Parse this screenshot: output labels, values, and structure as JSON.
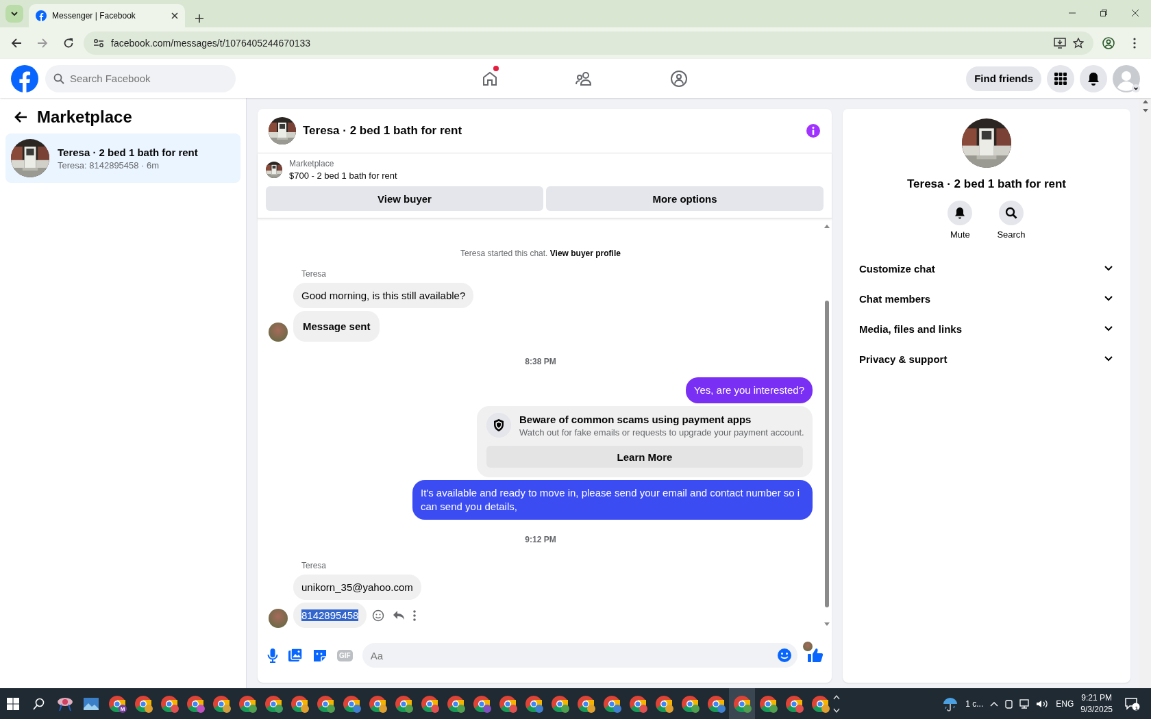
{
  "browser": {
    "tab_title": "Messenger | Facebook",
    "url": "facebook.com/messages/t/1076405244670133"
  },
  "header": {
    "search_placeholder": "Search Facebook",
    "nav": [
      {
        "kind": "home",
        "badge": true
      },
      {
        "kind": "friends",
        "badge": false
      },
      {
        "kind": "groups",
        "badge": false
      }
    ],
    "find_friends": "Find friends"
  },
  "sidebar": {
    "title": "Marketplace",
    "conversations": [
      {
        "title": "Teresa · 2 bed 1 bath for rent",
        "preview": "Teresa: 8142895458 · 6m",
        "selected": true
      }
    ]
  },
  "chat": {
    "title": "Teresa · 2 bed 1 bath for rent",
    "listing": {
      "label": "Marketplace",
      "title": "$700 - 2 bed 1 bath for rent"
    },
    "actions": [
      "View buyer",
      "More options"
    ],
    "intro": {
      "text": "Teresa started this chat.",
      "link": "View buyer profile"
    },
    "messages": [
      {
        "kind": "sender",
        "text": "Teresa"
      },
      {
        "kind": "incoming",
        "text": "Good morning, is this still available?",
        "emphasis": false,
        "avatar": false,
        "selected": false
      },
      {
        "kind": "incoming",
        "text": "Message sent",
        "emphasis": true,
        "avatar": true,
        "selected": false
      },
      {
        "kind": "timestamp",
        "text": "8:38 PM"
      },
      {
        "kind": "outgoing",
        "text": "Yes, are you interested?",
        "color": "#7a2ff4"
      },
      {
        "kind": "notice",
        "title": "Beware of common scams using payment apps",
        "text": "Watch out for fake emails or requests to upgrade your payment account.",
        "button": "Learn More"
      },
      {
        "kind": "outgoing",
        "text": "It's available and ready to move in, please send your email and contact number so i can send you details,",
        "color": "#3b4cf3"
      },
      {
        "kind": "timestamp",
        "text": "9:12 PM"
      },
      {
        "kind": "sender",
        "text": "Teresa"
      },
      {
        "kind": "incoming",
        "text": "unikorn_35@yahoo.com",
        "emphasis": false,
        "avatar": false,
        "selected": false
      },
      {
        "kind": "incoming",
        "text": "8142895458",
        "emphasis": false,
        "avatar": true,
        "selected": true
      }
    ],
    "composer": {
      "placeholder": "Aa",
      "gif": "GIF"
    }
  },
  "details": {
    "title": "Teresa · 2 bed 1 bath for rent",
    "actions": [
      {
        "kind": "bell",
        "label": "Mute"
      },
      {
        "kind": "search",
        "label": "Search"
      }
    ],
    "sections": [
      {
        "label": "Customize chat",
        "expanded": false
      },
      {
        "label": "Chat members",
        "expanded": false
      },
      {
        "label": "Media, files and links",
        "expanded": false
      },
      {
        "label": "Privacy & support",
        "expanded": false
      }
    ]
  },
  "taskbar": {
    "apps": [
      {
        "kind": "snip"
      },
      {
        "kind": "photos"
      },
      {
        "kind": "chrome",
        "color": "#7b3fa0",
        "badge": "M"
      },
      {
        "kind": "chrome",
        "color": "#e0a030"
      },
      {
        "kind": "chrome",
        "color": "#e05050"
      },
      {
        "kind": "chrome",
        "color": "#c050c0"
      },
      {
        "kind": "chrome",
        "color": "#d0a040"
      },
      {
        "kind": "chrome",
        "color": "#50a050"
      },
      {
        "kind": "chrome",
        "color": "#40a060"
      },
      {
        "kind": "chrome",
        "color": "#e0a030"
      },
      {
        "kind": "chrome",
        "color": "#50a050"
      },
      {
        "kind": "chrome",
        "color": "#4080d0"
      },
      {
        "kind": "chrome",
        "color": "#e0a030"
      },
      {
        "kind": "chrome",
        "color": "#50a050"
      },
      {
        "kind": "chrome",
        "color": "#e05050"
      },
      {
        "kind": "chrome",
        "color": "#50a050"
      },
      {
        "kind": "chrome",
        "color": "#8050c0"
      },
      {
        "kind": "chrome",
        "color": "#e05050"
      },
      {
        "kind": "chrome",
        "color": "#4080d0"
      },
      {
        "kind": "chrome",
        "color": "#50a050"
      },
      {
        "kind": "chrome",
        "color": "#e0a030"
      },
      {
        "kind": "chrome",
        "color": "#4080d0"
      },
      {
        "kind": "chrome",
        "color": "#e05050"
      },
      {
        "kind": "chrome",
        "color": "#e0a030"
      },
      {
        "kind": "chrome",
        "color": "#50a050"
      },
      {
        "kind": "chrome",
        "color": "#4080d0"
      },
      {
        "kind": "chrome",
        "color": "#50a050"
      },
      {
        "kind": "chrome",
        "color": "#50a050"
      },
      {
        "kind": "chrome",
        "color": "#e05050"
      },
      {
        "kind": "chrome",
        "color": "#e0a030"
      }
    ],
    "weather": "1 c...",
    "language": "ENG",
    "time": "9:21 PM",
    "date": "9/3/2025",
    "notifications": "1"
  }
}
